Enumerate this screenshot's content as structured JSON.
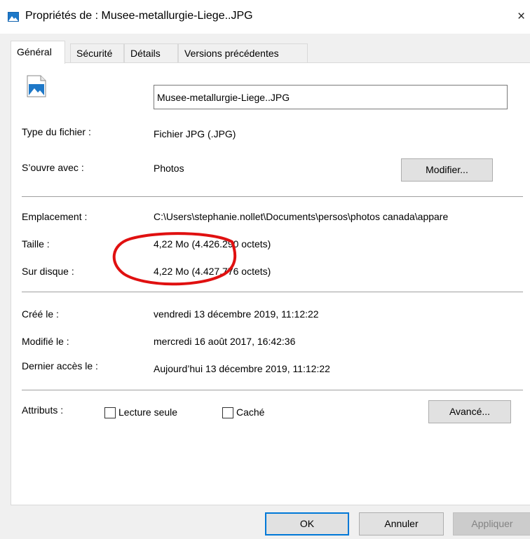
{
  "window": {
    "title": "Propriétés de : Musee-metallurgie-Liege..JPG",
    "close_glyph": "×",
    "icon": "image-file-icon"
  },
  "tabs": [
    {
      "label": "Général",
      "active": true
    },
    {
      "label": "Sécurité",
      "active": false
    },
    {
      "label": "Détails",
      "active": false
    },
    {
      "label": "Versions précédentes",
      "active": false
    }
  ],
  "general": {
    "file_icon": "jpg-image-icon",
    "file_name": "Musee-metallurgie-Liege..JPG",
    "type_label": "Type du fichier :",
    "type_value": "Fichier JPG (.JPG)",
    "opens_with_label": "S’ouvre avec :",
    "opens_with_value": "Photos",
    "change_button": "Modifier...",
    "location_label": "Emplacement :",
    "location_value": "C:\\Users\\stephanie.nollet\\Documents\\persos\\photos canada\\appare",
    "size_label": "Taille :",
    "size_value": "4,22 Mo (4.426.290 octets)",
    "size_on_disk_label": "Sur disque :",
    "size_on_disk_value": "4,22 Mo (4.427.776 octets)",
    "created_label": "Créé le :",
    "created_value": "vendredi 13 décembre 2019, 11:12:22",
    "modified_label": "Modifié le :",
    "modified_value": "mercredi 16 août 2017, 16:42:36",
    "accessed_label": "Dernier accès le :",
    "accessed_value": "Aujourd’hui 13 décembre 2019, 11:12:22",
    "attributes_label": "Attributs :",
    "readonly_label": "Lecture seule",
    "readonly_checked": false,
    "hidden_label": "Caché",
    "hidden_checked": false,
    "advanced_button": "Avancé..."
  },
  "footer": {
    "ok": "OK",
    "cancel": "Annuler",
    "apply": "Appliquer"
  },
  "colors": {
    "annotation": "#e01010",
    "accent": "#0078d7",
    "icon_blue": "#1e78c8"
  }
}
